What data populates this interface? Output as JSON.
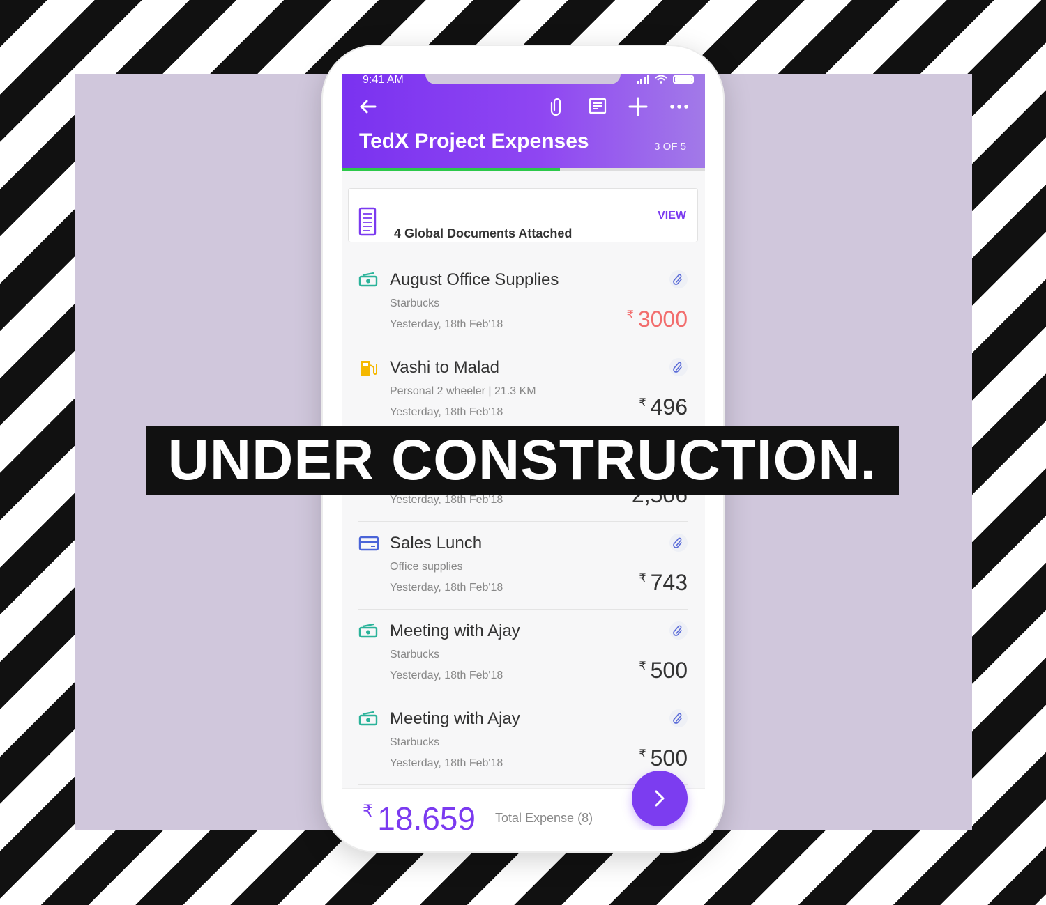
{
  "overlay": {
    "banner_text": "UNDER CONSTRUCTION."
  },
  "status_bar": {
    "time": "9:41 AM"
  },
  "header": {
    "title": "TedX Project Expenses",
    "counter": "3 OF 5",
    "progress": 0.6,
    "icons": [
      "back-arrow-icon",
      "paperclip-icon",
      "notes-icon",
      "add-icon",
      "more-icon"
    ]
  },
  "documents": {
    "text": "4 Global Documents Attached",
    "action": "VIEW"
  },
  "expenses": [
    {
      "title": "August Office Supplies",
      "subtitle": "Starbucks",
      "date": "Yesterday, 18th Feb'18",
      "currency": "₹",
      "amount": "3000",
      "icon": "cash-icon",
      "highlight": true
    },
    {
      "title": "Vashi to Malad",
      "subtitle": "Personal 2 wheeler | 21.3 KM",
      "date": "Yesterday, 18th Feb'18",
      "currency": "₹",
      "amount": "496",
      "icon": "fuel-icon"
    },
    {
      "title": "",
      "subtitle": "",
      "date": "Yesterday, 18th Feb'18",
      "currency": "₹",
      "amount": "2,506",
      "icon": "card-icon"
    },
    {
      "title": "Sales Lunch",
      "subtitle": "Office supplies",
      "date": "Yesterday, 18th Feb'18",
      "currency": "₹",
      "amount": "743",
      "icon": "card-icon"
    },
    {
      "title": "Meeting with Ajay",
      "subtitle": "Starbucks",
      "date": "Yesterday, 18th Feb'18",
      "currency": "₹",
      "amount": "500",
      "icon": "cash-icon"
    },
    {
      "title": "Meeting with Ajay",
      "subtitle": "Starbucks",
      "date": "Yesterday, 18th Feb'18",
      "currency": "₹",
      "amount": "500",
      "icon": "cash-icon"
    }
  ],
  "footer": {
    "currency": "₹",
    "total": "18,659",
    "label": "Total Expense  (8)"
  },
  "colors": {
    "accent": "#7b3af0",
    "progress": "#2cc84a",
    "negative": "#f26d6d",
    "cash": "#2bb39a",
    "fuel": "#f5b800",
    "card": "#4a64d8"
  }
}
